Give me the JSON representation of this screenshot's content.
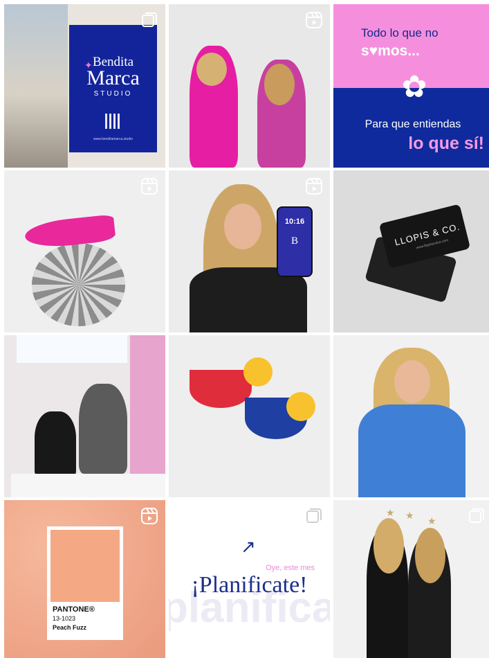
{
  "posts": [
    {
      "badge": "carousel",
      "poster": {
        "line1": "Bendita",
        "line2": "Marca",
        "line3": "STUDIO",
        "url": "www.benditamarca.studio"
      }
    },
    {
      "badge": "reel"
    },
    {
      "badge": "none",
      "text": {
        "line1": "Todo lo que no",
        "line2": "s♥mos...",
        "line3": "Para que entiendas",
        "line4": "lo que sí!"
      }
    },
    {
      "badge": "reel"
    },
    {
      "badge": "reel",
      "phone": {
        "time": "10:16",
        "letter": "B"
      }
    },
    {
      "badge": "none",
      "card": {
        "logo": "LLOPIS & CO.",
        "url": "www.llopisandco.com"
      }
    },
    {
      "badge": "none"
    },
    {
      "badge": "none"
    },
    {
      "badge": "none"
    },
    {
      "badge": "reel",
      "pantone": {
        "brand": "PANTONE®",
        "code": "13-1023",
        "name": "Peach Fuzz"
      }
    },
    {
      "badge": "carousel",
      "text": {
        "small": "Oye, este mes",
        "big": "¡Planificate!",
        "bg": "planifica"
      }
    },
    {
      "badge": "carousel"
    }
  ],
  "colors": {
    "brand_blue": "#13249a",
    "brand_pink": "#f58fdd",
    "deep_blue": "#0f2a9c"
  },
  "icons": {
    "reel": "reel-icon",
    "carousel": "carousel-icon"
  }
}
